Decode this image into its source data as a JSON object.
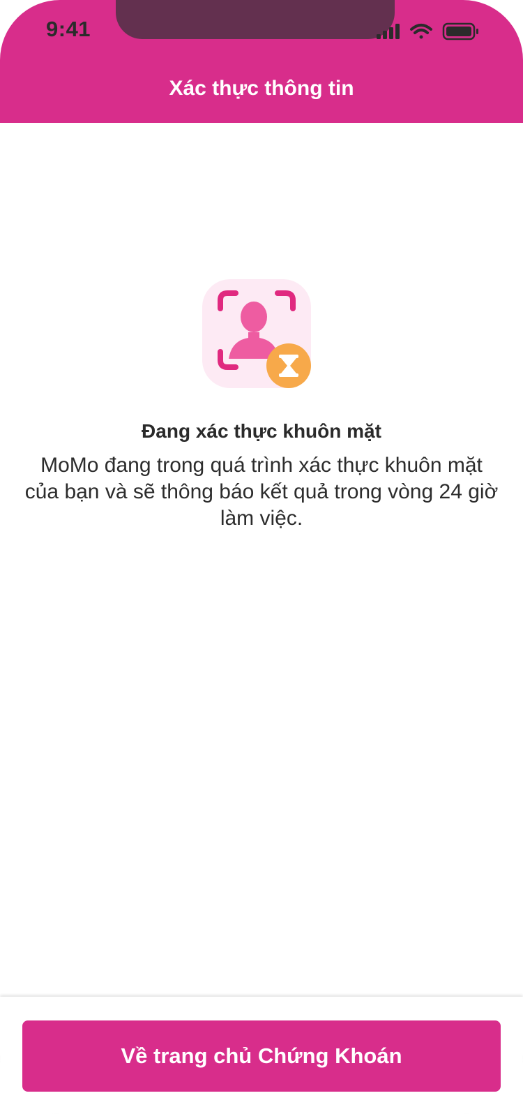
{
  "status_bar": {
    "time": "9:41",
    "signal_icon": "cellular-signal-icon",
    "wifi_icon": "wifi-icon",
    "battery_icon": "battery-icon"
  },
  "header": {
    "title": "Xác thực thông tin"
  },
  "main": {
    "illustration_icon": "face-verification-pending-icon",
    "title": "Đang xác thực khuôn mặt",
    "description": "MoMo đang trong quá trình xác thực khuôn mặt của bạn và sẽ thông báo kết quả trong vòng 24 giờ làm việc."
  },
  "footer": {
    "button_label": "Về trang chủ Chứng Khoán"
  },
  "colors": {
    "brand": "#d82d8b",
    "notch": "#63304f",
    "accent_orange": "#f7a94a",
    "icon_bg": "#fdeaf4"
  }
}
